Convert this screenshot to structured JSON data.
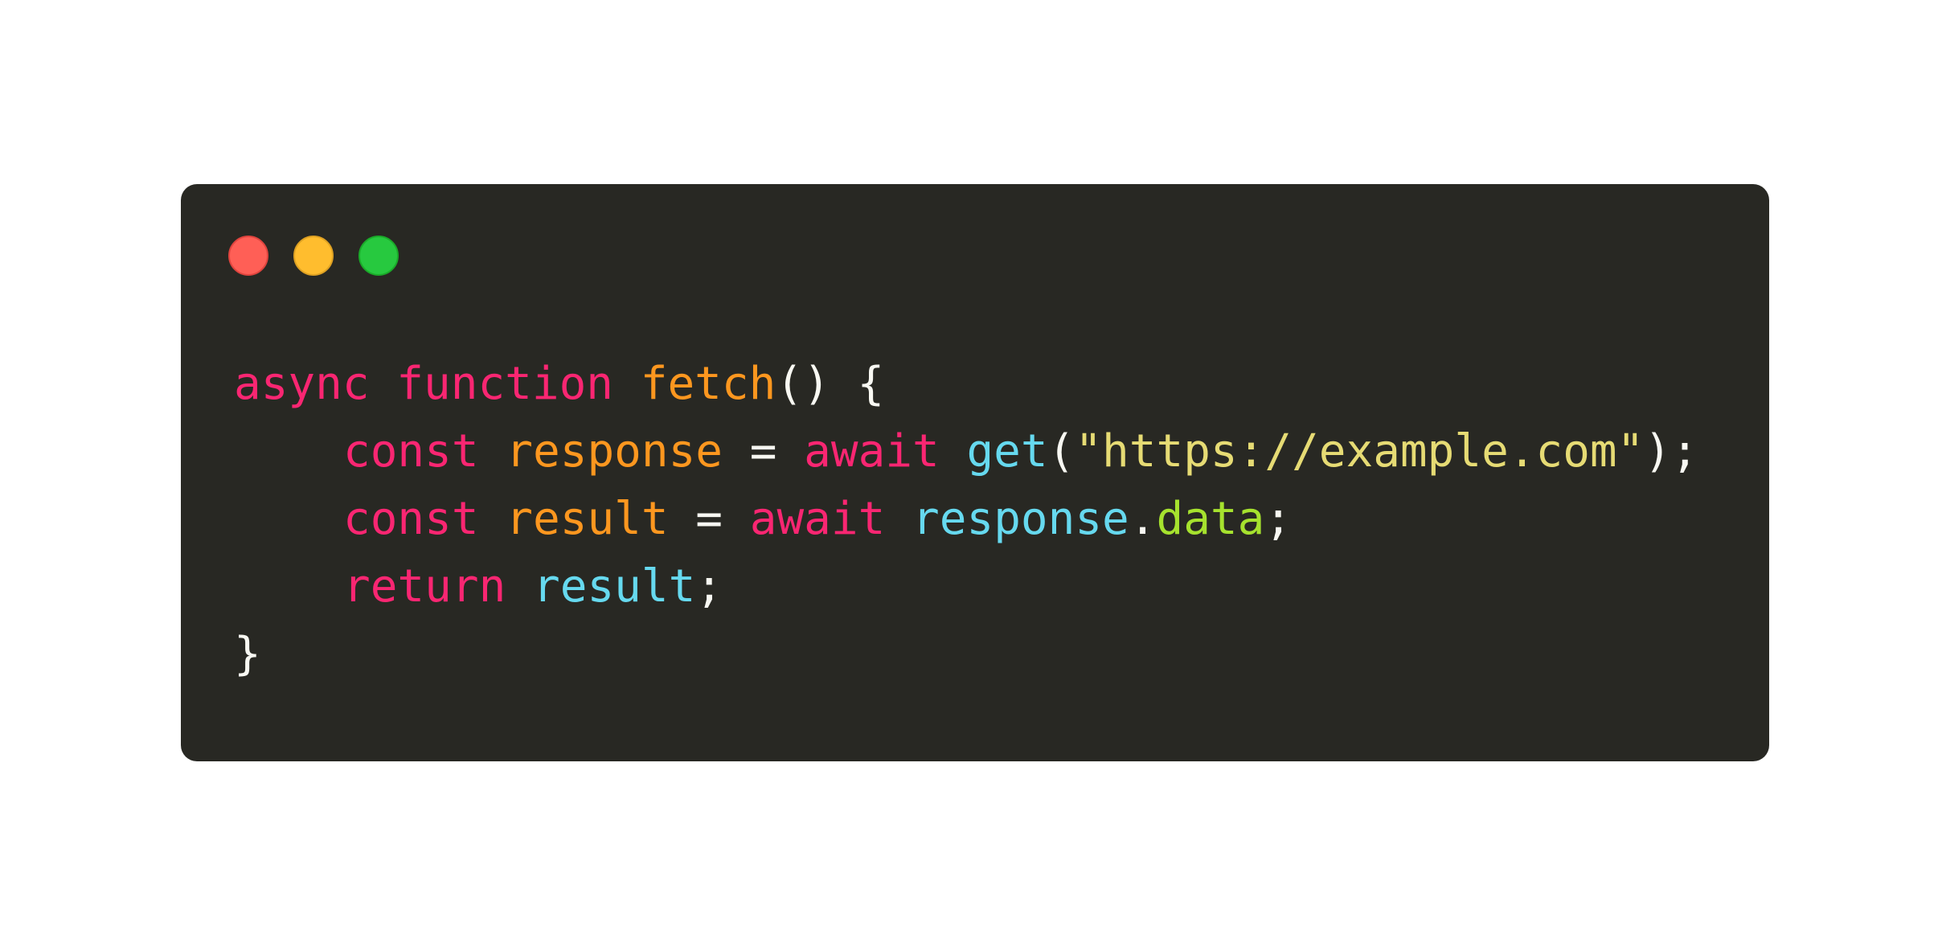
{
  "window_buttons": [
    {
      "name": "close",
      "color": "#ff5f56"
    },
    {
      "name": "minimize",
      "color": "#ffbd2e"
    },
    {
      "name": "maximize",
      "color": "#27c93f"
    }
  ],
  "code_lines": [
    {
      "indent": 0,
      "tokens": [
        {
          "text": "async",
          "color": "#f92672"
        },
        {
          "text": " ",
          "color": "#f8f8f2"
        },
        {
          "text": "function",
          "color": "#f92672"
        },
        {
          "text": " ",
          "color": "#f8f8f2"
        },
        {
          "text": "fetch",
          "color": "#fd971f"
        },
        {
          "text": "() {",
          "color": "#f8f8f2"
        }
      ]
    },
    {
      "indent": 1,
      "tokens": [
        {
          "text": "const",
          "color": "#f92672"
        },
        {
          "text": " ",
          "color": "#f8f8f2"
        },
        {
          "text": "response",
          "color": "#fd971f"
        },
        {
          "text": " = ",
          "color": "#f8f8f2"
        },
        {
          "text": "await",
          "color": "#f92672"
        },
        {
          "text": " ",
          "color": "#f8f8f2"
        },
        {
          "text": "get",
          "color": "#66d9ef"
        },
        {
          "text": "(",
          "color": "#f8f8f2"
        },
        {
          "text": "\"https://example.com\"",
          "color": "#e6db74"
        },
        {
          "text": ");",
          "color": "#f8f8f2"
        }
      ]
    },
    {
      "indent": 1,
      "tokens": [
        {
          "text": "const",
          "color": "#f92672"
        },
        {
          "text": " ",
          "color": "#f8f8f2"
        },
        {
          "text": "result",
          "color": "#fd971f"
        },
        {
          "text": " = ",
          "color": "#f8f8f2"
        },
        {
          "text": "await",
          "color": "#f92672"
        },
        {
          "text": " ",
          "color": "#f8f8f2"
        },
        {
          "text": "response",
          "color": "#66d9ef"
        },
        {
          "text": ".",
          "color": "#f8f8f2"
        },
        {
          "text": "data",
          "color": "#a6e22e"
        },
        {
          "text": ";",
          "color": "#f8f8f2"
        }
      ]
    },
    {
      "indent": 1,
      "tokens": [
        {
          "text": "return",
          "color": "#f92672"
        },
        {
          "text": " ",
          "color": "#f8f8f2"
        },
        {
          "text": "result",
          "color": "#66d9ef"
        },
        {
          "text": ";",
          "color": "#f8f8f2"
        }
      ]
    },
    {
      "indent": 0,
      "tokens": [
        {
          "text": "}",
          "color": "#f8f8f2"
        }
      ]
    }
  ],
  "theme": {
    "background": "#282823",
    "foreground": "#f8f8f2",
    "page_background": "#ffffff"
  }
}
